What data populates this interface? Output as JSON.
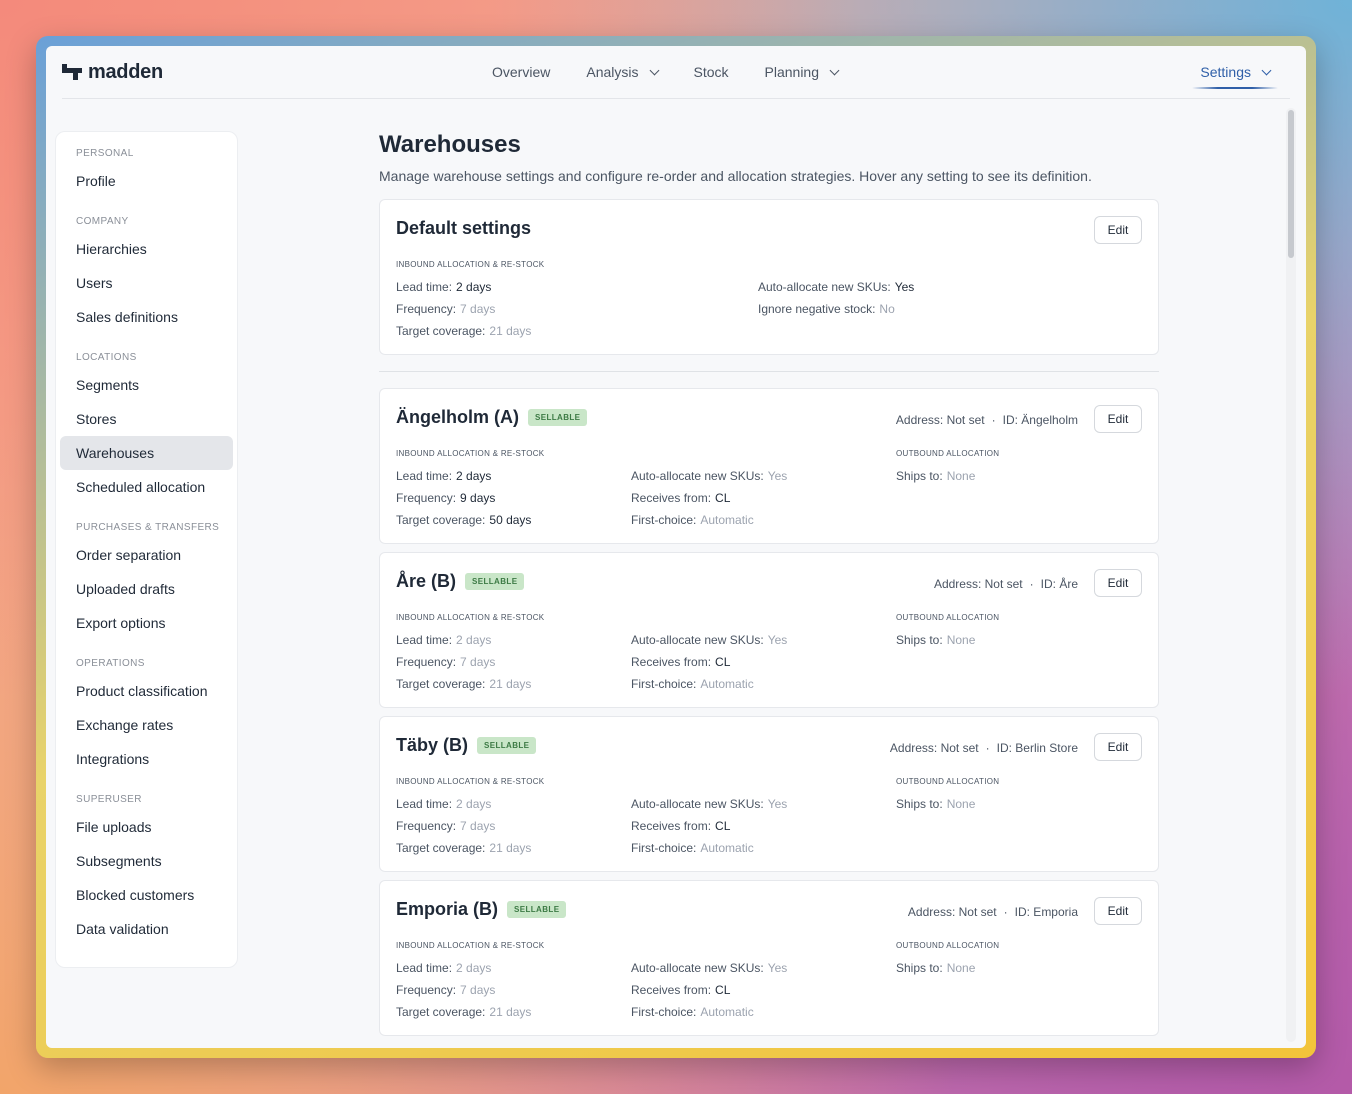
{
  "app": {
    "logo_text": "madden"
  },
  "nav": {
    "items": [
      {
        "label": "Overview",
        "has_dropdown": false
      },
      {
        "label": "Analysis",
        "has_dropdown": true
      },
      {
        "label": "Stock",
        "has_dropdown": false
      },
      {
        "label": "Planning",
        "has_dropdown": true
      }
    ],
    "settings_label": "Settings"
  },
  "sidebar": {
    "sections": [
      {
        "title": "PERSONAL",
        "items": [
          "Profile"
        ]
      },
      {
        "title": "COMPANY",
        "items": [
          "Hierarchies",
          "Users",
          "Sales definitions"
        ]
      },
      {
        "title": "LOCATIONS",
        "items": [
          "Segments",
          "Stores",
          "Warehouses",
          "Scheduled allocation"
        ]
      },
      {
        "title": "PURCHASES & TRANSFERS",
        "items": [
          "Order separation",
          "Uploaded drafts",
          "Export options"
        ]
      },
      {
        "title": "OPERATIONS",
        "items": [
          "Product classification",
          "Exchange rates",
          "Integrations"
        ]
      },
      {
        "title": "SUPERUSER",
        "items": [
          "File uploads",
          "Subsegments",
          "Blocked customers",
          "Data validation"
        ]
      }
    ],
    "active_item": "Warehouses"
  },
  "page": {
    "title": "Warehouses",
    "subtitle": "Manage warehouse settings and configure re-order and allocation strategies. Hover any setting to see its definition."
  },
  "default_settings": {
    "title": "Default settings",
    "edit_label": "Edit",
    "section_label": "INBOUND ALLOCATION & RE-STOCK",
    "lead_time": {
      "label": "Lead time:",
      "value": "2 days"
    },
    "frequency": {
      "label": "Frequency:",
      "value": "7 days"
    },
    "target_coverage": {
      "label": "Target coverage:",
      "value": "21 days"
    },
    "auto_allocate": {
      "label": "Auto-allocate new SKUs:",
      "value": "Yes"
    },
    "ignore_negative": {
      "label": "Ignore negative stock:",
      "value": "No"
    }
  },
  "labels": {
    "inbound": "INBOUND ALLOCATION & RE-STOCK",
    "outbound": "OUTBOUND ALLOCATION",
    "lead_time": "Lead time:",
    "frequency": "Frequency:",
    "target_coverage": "Target coverage:",
    "auto_allocate": "Auto-allocate new SKUs:",
    "receives_from": "Receives from:",
    "first_choice": "First-choice:",
    "ships_to": "Ships to:",
    "edit": "Edit",
    "badge": "SELLABLE"
  },
  "warehouses": [
    {
      "name": "Ängelholm (A)",
      "address": "Address: Not set",
      "id": "ID: Ängelholm",
      "lead_time": "2 days",
      "frequency": "9 days",
      "target_coverage": "50 days",
      "auto_allocate": "Yes",
      "receives_from": "CL",
      "first_choice": "Automatic",
      "ships_to": "None"
    },
    {
      "name": "Åre (B)",
      "address": "Address: Not set",
      "id": "ID: Åre",
      "lead_time": "2 days",
      "frequency": "7 days",
      "target_coverage": "21 days",
      "auto_allocate": "Yes",
      "receives_from": "CL",
      "first_choice": "Automatic",
      "ships_to": "None"
    },
    {
      "name": "Täby (B)",
      "address": "Address: Not set",
      "id": "ID: Berlin Store",
      "lead_time": "2 days",
      "frequency": "7 days",
      "target_coverage": "21 days",
      "auto_allocate": "Yes",
      "receives_from": "CL",
      "first_choice": "Automatic",
      "ships_to": "None"
    },
    {
      "name": "Emporia (B)",
      "address": "Address: Not set",
      "id": "ID: Emporia",
      "lead_time": "2 days",
      "frequency": "7 days",
      "target_coverage": "21 days",
      "auto_allocate": "Yes",
      "receives_from": "CL",
      "first_choice": "Automatic",
      "ships_to": "None"
    }
  ]
}
